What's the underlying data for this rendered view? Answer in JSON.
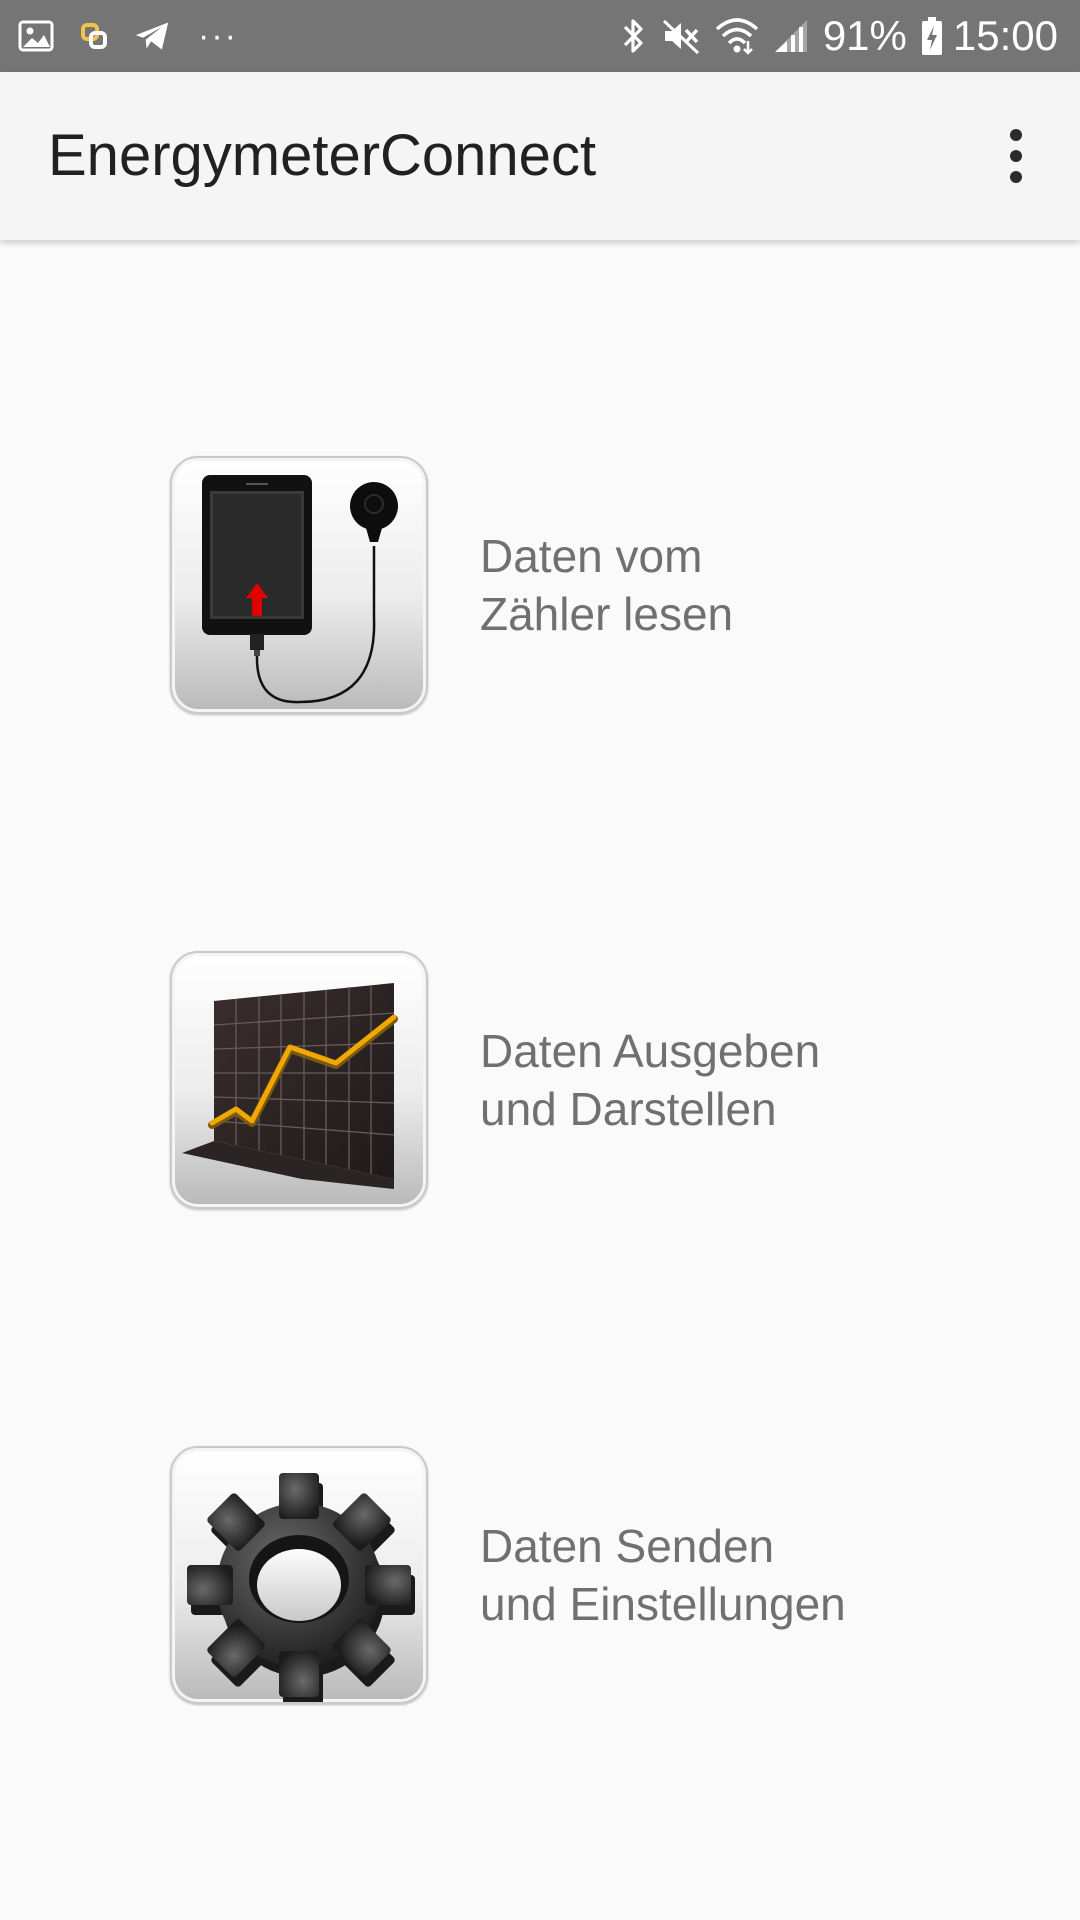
{
  "status_bar": {
    "left_icons": [
      "gallery-icon",
      "app-notification-icon",
      "telegram-icon"
    ],
    "more_indicator": "···",
    "right_icons": [
      "bluetooth-icon",
      "mute-icon",
      "wifi-icon",
      "signal-icon",
      "battery-charging-icon"
    ],
    "battery": "91%",
    "time": "15:00"
  },
  "toolbar": {
    "title": "EnergymeterConnect",
    "overflow_icon": "more-vert-icon"
  },
  "menu": {
    "items": [
      {
        "icon": "tablet-meter-connect-icon",
        "label": "Daten vom\nZähler lesen"
      },
      {
        "icon": "line-chart-icon",
        "label": "Daten Ausgeben\nund Darstellen"
      },
      {
        "icon": "gear-icon",
        "label": "Daten Senden\nund Einstellungen"
      }
    ]
  },
  "colors": {
    "status_bar": "#757575",
    "toolbar": "#f5f5f5",
    "background": "#fafafa",
    "title_text": "#212121",
    "label_text": "#707070",
    "chart_line": "#f0a800",
    "arrow_red": "#e00000"
  }
}
